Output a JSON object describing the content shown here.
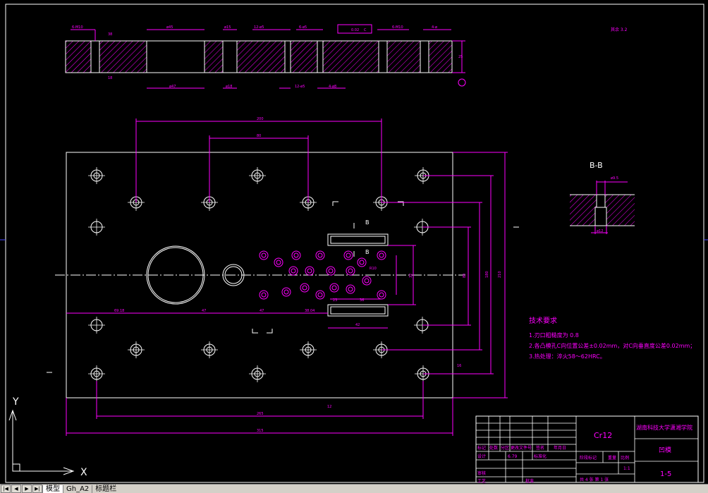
{
  "drawing": {
    "top_view_dims": {
      "d1": "6-M10",
      "d2": "38",
      "d3": "ø45",
      "d4": "ø15",
      "d5": "12-ø5",
      "d6": "6-ø5",
      "d7": "0.02",
      "d8": "C",
      "d9": "6-M10",
      "d10": "4-ø",
      "d11": "25",
      "d12": "ø47",
      "d13": "ø18",
      "d14": "12-ø5",
      "d15": "4-ø8",
      "d16": "18"
    },
    "plan_dims": {
      "w200": "200",
      "w80": "80",
      "h210": "210",
      "h180": "180",
      "h80": "80",
      "h32": "32",
      "x69": "69.18",
      "x47a": "47",
      "x47b": "47",
      "x38": "38.04",
      "x23": "23",
      "x36": "36",
      "x42": "42",
      "w265": "265",
      "w315": "315",
      "r10": "R10",
      "tol12": "12",
      "tol16": "16",
      "b_label": "B"
    },
    "section": {
      "title": "B-B",
      "d1": "ø9.5",
      "d2": "ø12"
    },
    "roughness_note": "其余 3.2",
    "tech_req": {
      "title": "技术要求",
      "line1": "1.刃口粗糙度为 0.8",
      "line2": "2.各凸模孔C向位置公差±0.02mm，对C向垂直度公差0.02mm；",
      "line3": "3.热处理：淬火58～62HRC。"
    },
    "title_block": {
      "material": "Cr12",
      "school": "湖南科技大学潇湘学院",
      "part_name": "凹模",
      "drawing_no": "1-5",
      "h_mark": "标记",
      "h_count": "处数",
      "h_zone": "分区",
      "h_doc": "更改文件号",
      "h_sign": "签名",
      "h_date": "年月日",
      "design": "设计",
      "date_val": "6.79",
      "std": "标准化",
      "stage": "阶段标记",
      "weight": "重量",
      "scale": "比例",
      "scale_val": "1:1",
      "review": "审核",
      "craft": "工艺",
      "approve": "批准",
      "sheets": "共 4 张  第 1 张"
    }
  },
  "ucs": {
    "y": "Y",
    "x": "X"
  },
  "tabs": {
    "model": "模型",
    "layout1": "Gh_A2",
    "layout2": "标题栏"
  },
  "colors": {
    "line": "#ff00ff",
    "outline": "#ffffff",
    "bg": "#000000"
  }
}
